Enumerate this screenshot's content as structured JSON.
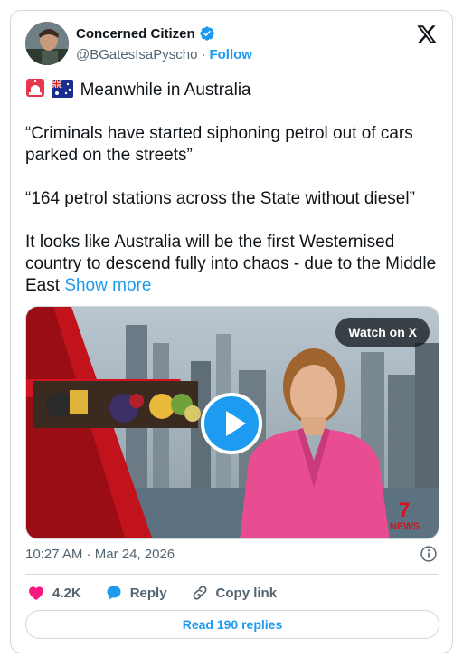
{
  "author": {
    "name": "Concerned Citizen",
    "handle": "@BGatesIsaPyscho",
    "separator": "·",
    "follow_label": "Follow",
    "verified_color": "#1d9bf0",
    "avatar_icon": "avatar-photo"
  },
  "tweet": {
    "line1": "Meanwhile in Australia",
    "line1_emojis": [
      "siren-icon",
      "australia-flag-icon"
    ],
    "para2": "“Criminals have started siphoning petrol out of cars parked on the streets”",
    "para3": "“164 petrol stations across the State without diesel”",
    "para4": "It looks like Australia will be the first Westernised country to descend fully into chaos - due to the Middle East",
    "show_more": "Show more"
  },
  "media": {
    "watch_label": "Watch on X",
    "play_icon": "play-icon"
  },
  "meta": {
    "time": "10:27 AM",
    "separator": "·",
    "date": "Mar 24, 2026"
  },
  "actions": {
    "likes": "4.2K",
    "reply_label": "Reply",
    "copy_label": "Copy link"
  },
  "replies_button": "Read 190 replies",
  "colors": {
    "accent": "#1d9bf0",
    "like": "#f91880",
    "muted": "#536471",
    "border": "#cfd9de"
  }
}
